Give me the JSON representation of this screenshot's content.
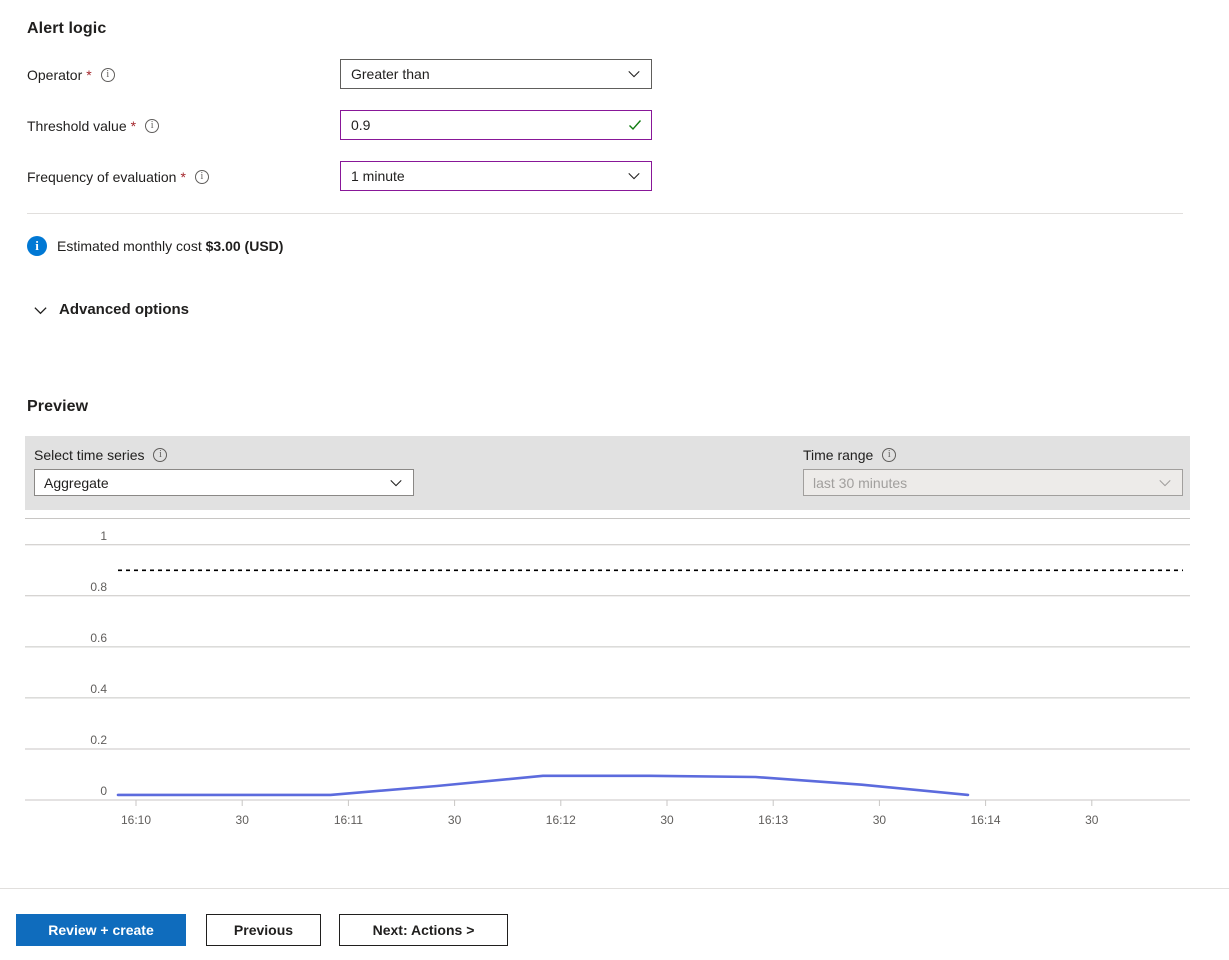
{
  "alert_logic": {
    "title": "Alert logic",
    "fields": [
      {
        "label": "Operator",
        "required_marker": "*",
        "value": "Greater than",
        "control": "dropdown",
        "border": "#605e5c"
      },
      {
        "label": "Threshold value",
        "required_marker": "*",
        "value": "0.9",
        "control": "textbox-valid",
        "border": "#881798"
      },
      {
        "label": "Frequency of evaluation",
        "required_marker": "*",
        "value": "1 minute",
        "control": "dropdown",
        "border": "#881798"
      }
    ]
  },
  "cost": {
    "icon": "info-icon",
    "prefix": "Estimated monthly cost ",
    "amount": "$3.00 (USD)",
    "accent": "#0078d4"
  },
  "advanced": {
    "label": "Advanced options",
    "chevron": "chevron-down-icon"
  },
  "preview": {
    "title": "Preview",
    "time_series": {
      "label": "Select time series",
      "value": "Aggregate",
      "info": "info-icon"
    },
    "time_range": {
      "label": "Time range",
      "value": "last 30 minutes",
      "info": "info-icon",
      "disabled": true
    }
  },
  "chart_data": {
    "type": "line",
    "title": "",
    "xlabel": "",
    "ylabel": "",
    "ylim": [
      0,
      1.05
    ],
    "yticks": [
      0,
      0.2,
      0.4,
      0.6,
      0.8,
      1
    ],
    "ytick_labels": [
      "0",
      "0.2",
      "0.4",
      "0.6",
      "0.8",
      "1"
    ],
    "grid": true,
    "legend": "none",
    "xtick_labels": [
      "16:10",
      "30",
      "16:11",
      "30",
      "16:12",
      "30",
      "16:13",
      "30",
      "16:14",
      "30"
    ],
    "threshold": {
      "value": 0.9,
      "style": "dashed",
      "color": "#000000",
      "label": "0.9"
    },
    "series": [
      {
        "name": "Aggregate",
        "color": "#5c6bdd",
        "x": [
          "16:10",
          "16:10:30",
          "16:11",
          "16:11:30",
          "16:12",
          "16:12:30",
          "16:13",
          "16:13:30",
          "16:14"
        ],
        "values": [
          0.02,
          0.02,
          0.02,
          0.055,
          0.095,
          0.095,
          0.09,
          0.06,
          0.02
        ]
      }
    ]
  },
  "footer": {
    "review_label": "Review + create",
    "previous_label": "Previous",
    "next_label": "Next: Actions >",
    "primary_color": "#0f6cbd"
  }
}
